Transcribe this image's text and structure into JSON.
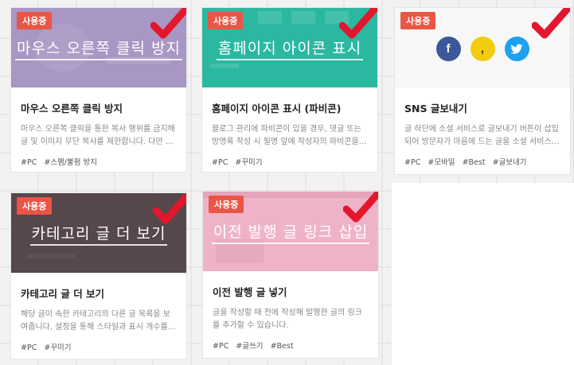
{
  "status_badge": "사용중",
  "colors": {
    "badge": "#ea5545",
    "check": "#e3162d",
    "purple": "#a896c4",
    "teal": "#2bb8a1",
    "dark": "#55474a",
    "pink": "#efb3c8",
    "facebook": "#3b5998",
    "kakaostory": "#f2cc0e",
    "twitter": "#1da1f2"
  },
  "cards": [
    {
      "thumb_text": "마우스 오른쪽 클릭 방지",
      "title": "마우스 오른쪽 클릭 방지",
      "desc": "마우스 오른쪽 클릭을 통한 복사 행위를 금지해 글 및 이미지 무단 복사를 제한합니다. 다만 …",
      "tags": [
        "#PC",
        "#스팸/불펌 방지"
      ]
    },
    {
      "thumb_text": "홈페이지 아이콘 표시",
      "title": "홈페이지 아이콘 표시 (파비콘)",
      "desc": "블로그 관리에 파비콘이 있을 경우, 댓글 또는 방명록 작성 시 필명 앞에 작성자의 파비콘을…",
      "tags": [
        "#PC",
        "#꾸미기"
      ]
    },
    {
      "thumb_text": "",
      "icons": [
        "facebook-icon",
        "kakaostory-icon",
        "twitter-icon"
      ],
      "title": "SNS 글보내기",
      "desc": "글 하단에 소셜 서비스로 글보내기 버튼이 삽입되어 방문자가 마음에 드는 글을 소셜 서비스…",
      "tags": [
        "#PC",
        "#모바일",
        "#Best",
        "#글보내기"
      ]
    },
    {
      "thumb_text": "카테고리 글 더 보기",
      "title": "카테고리 글 더 보기",
      "desc": "해당 글이 속한 카테고리의 다른 글 목록을 보여줍니다. 설정을 통해 스타일과 표시 개수를…",
      "tags": [
        "#PC",
        "#꾸미기"
      ]
    },
    {
      "thumb_text": "이전 발행 글 링크 삽입",
      "title": "이전 발행 글 넣기",
      "desc": "글을 작성할 때 전에 작성해 발행한 글의 링크를 추가할 수 있습니다.",
      "tags": [
        "#PC",
        "#글쓰기",
        "#Best"
      ]
    }
  ]
}
